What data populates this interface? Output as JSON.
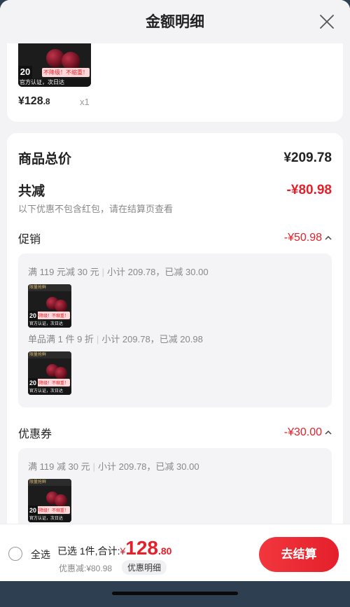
{
  "header": {
    "title": "金额明细"
  },
  "top_item": {
    "badge": "20",
    "tag": "不降级！不缩重！",
    "band": "官方认证，次日达",
    "price_int": "¥128",
    "price_dec": ".8",
    "qty": "x1"
  },
  "summary": {
    "total_label": "商品总价",
    "total_value": "¥209.78",
    "reduce_label": "共减",
    "reduce_value": "-¥80.98",
    "note": "以下优惠不包含红包，请在结算页查看"
  },
  "promo": {
    "label": "促销",
    "value": "-¥50.98",
    "rules": [
      {
        "rule": "满 119 元减 30 元",
        "detail": "小计 209.78，已减 30.00"
      },
      {
        "rule": "单品满 1 件 9 折",
        "detail": "小计 209.78，已减 20.98"
      }
    ]
  },
  "coupon": {
    "label": "优惠券",
    "value": "-¥30.00",
    "rules": [
      {
        "rule": "满 119 减 30 元",
        "detail": "小计 209.78，已减 30.00"
      }
    ]
  },
  "thumb": {
    "badge": "20",
    "tag": "不降级！不缩重！",
    "band": "官方认证，次日达",
    "topbar": "限量抢鲜"
  },
  "footer": {
    "select_all": "全选",
    "selected_text": "已选 1件,合计:",
    "currency": "¥",
    "total_int": "128",
    "total_dec": ".80",
    "discount": "优惠减:¥80.98",
    "detail_button": "优惠明细",
    "checkout": "去结算"
  },
  "colors": {
    "accent": "#e4202b",
    "bg": "#f3f3f5"
  }
}
